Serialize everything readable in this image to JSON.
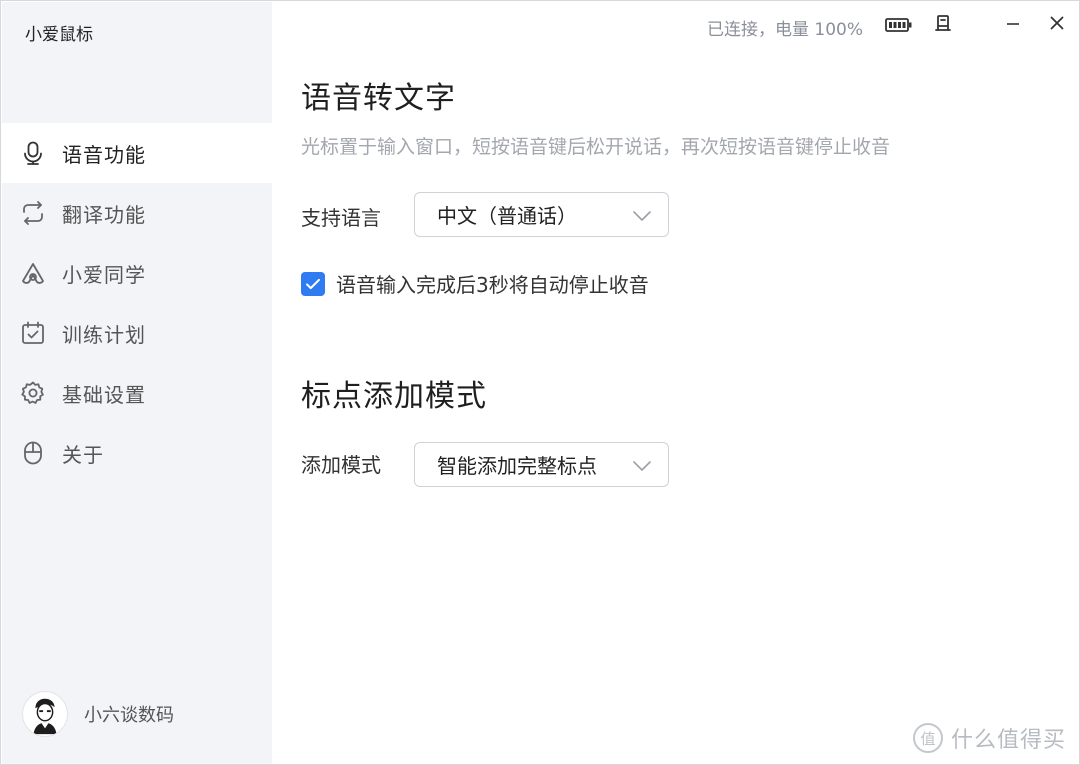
{
  "app": {
    "title": "小爱鼠标"
  },
  "titlebar": {
    "status": "已连接，电量 100%",
    "battery_icon": "battery-full-icon",
    "pin_icon": "pin-icon",
    "minimize_icon": "minimize-icon",
    "close_icon": "close-icon"
  },
  "sidebar": {
    "items": [
      {
        "label": "语音功能",
        "icon": "microphone-icon",
        "active": true
      },
      {
        "label": "翻译功能",
        "icon": "translate-loop-icon",
        "active": false
      },
      {
        "label": "小爱同学",
        "icon": "xiaoai-icon",
        "active": false
      },
      {
        "label": "训练计划",
        "icon": "calendar-check-icon",
        "active": false
      },
      {
        "label": "基础设置",
        "icon": "gear-icon",
        "active": false
      },
      {
        "label": "关于",
        "icon": "mouse-icon",
        "active": false
      }
    ],
    "user": {
      "name": "小六谈数码",
      "avatar": "avatar"
    }
  },
  "main": {
    "voice": {
      "title": "语音转文字",
      "hint": "光标置于输入窗口，短按语音键后松开说话，再次短按语音键停止收音",
      "language_label": "支持语言",
      "language_value": "中文（普通话）",
      "auto_stop_checked": true,
      "auto_stop_label": "语音输入完成后3秒将自动停止收音"
    },
    "punctuation": {
      "title": "标点添加模式",
      "mode_label": "添加模式",
      "mode_value": "智能添加完整标点"
    }
  },
  "watermark": {
    "logo_char": "值",
    "text": "什么值得买"
  },
  "colors": {
    "accent": "#2f7bf2",
    "sidebar_bg": "#f3f4f7",
    "hint_text": "#a3a7ae"
  }
}
